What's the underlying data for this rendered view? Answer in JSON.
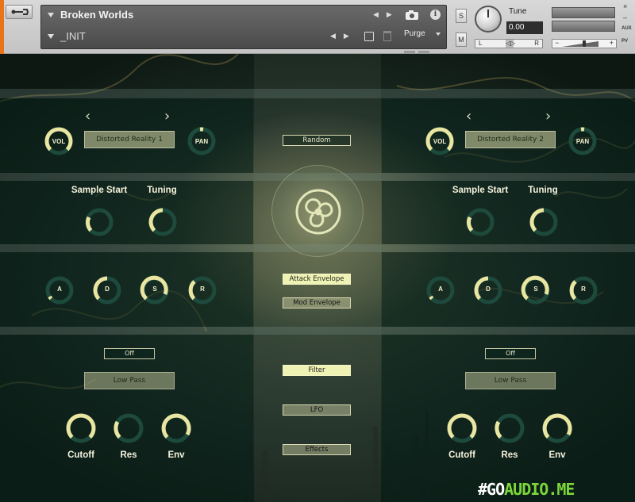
{
  "header": {
    "instrument_name": "Broken Worlds",
    "preset_name": "_INIT",
    "purge_label": "Purge",
    "solo_label": "S",
    "mute_label": "M",
    "tune_label": "Tune",
    "tune_value": "0.00",
    "pan_left": "L",
    "pan_right": "R",
    "pan_center": "◁▷",
    "vol_minus": "−",
    "vol_plus": "+",
    "close_label": "×",
    "minimize_label": "–",
    "aux_label": "AUX",
    "pv_label": "PV",
    "nav_left": "◀",
    "nav_right": "▶",
    "info_label": "i"
  },
  "center": {
    "random": "Random",
    "attack_envelope": "Attack Envelope",
    "mod_envelope": "Mod Envelope",
    "filter": "Filter",
    "lfo": "LFO",
    "effects": "Effects"
  },
  "left": {
    "vol_label": "VOL",
    "pan_label": "PAN",
    "sample_name": "Distorted Reality 1",
    "prev": "‹",
    "next": "›",
    "sample_start": "Sample Start",
    "tuning": "Tuning",
    "a": "A",
    "d": "D",
    "s": "S",
    "r": "R",
    "filter_state": "Off",
    "filter_type": "Low Pass",
    "cutoff": "Cutoff",
    "res": "Res",
    "env": "Env"
  },
  "right": {
    "vol_label": "VOL",
    "pan_label": "PAN",
    "sample_name": "Distorted Reality 2",
    "prev": "‹",
    "next": "›",
    "sample_start": "Sample Start",
    "tuning": "Tuning",
    "a": "A",
    "d": "D",
    "s": "S",
    "r": "R",
    "filter_state": "Off",
    "filter_type": "Low Pass",
    "cutoff": "Cutoff",
    "res": "Res",
    "env": "Env"
  },
  "watermark": {
    "part1": "#GO",
    "part2": "AUDIO.ME"
  },
  "colors": {
    "knob_active": "#e9e6a2",
    "knob_track": "#1d4a3c",
    "orange": "#e8741a",
    "button_active": "#eef2b2"
  }
}
